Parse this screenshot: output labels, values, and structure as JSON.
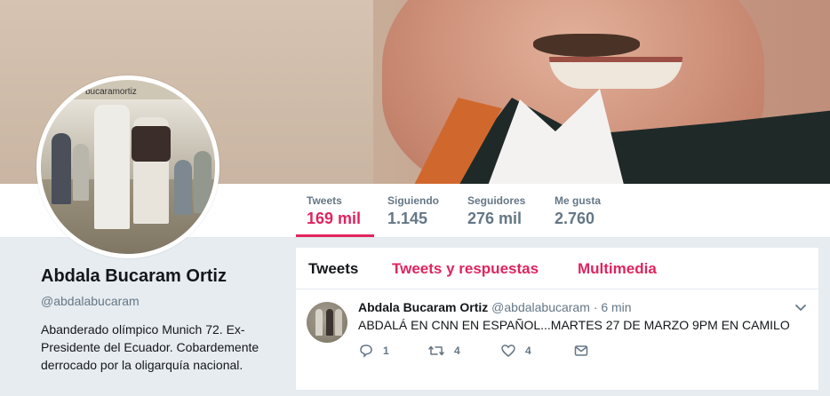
{
  "banner": {
    "description_icon": "banner-photo"
  },
  "avatar": {
    "caption": "bucaramortiz"
  },
  "nav": {
    "stats": [
      {
        "label": "Tweets",
        "value": "169 mil",
        "active": true
      },
      {
        "label": "Siguiendo",
        "value": "1.145"
      },
      {
        "label": "Seguidores",
        "value": "276 mil"
      },
      {
        "label": "Me gusta",
        "value": "2.760"
      }
    ]
  },
  "profile": {
    "name": "Abdala Bucaram Ortiz",
    "handle": "@abdalabucaram",
    "bio": "Abanderado olímpico Munich 72. Ex-Presidente del Ecuador. Cobardemente derrocado por la oligarquía nacional."
  },
  "timeline": {
    "tabs": [
      {
        "label": "Tweets",
        "current": true
      },
      {
        "label": "Tweets y respuestas"
      },
      {
        "label": "Multimedia"
      }
    ],
    "tweet": {
      "name": "Abdala Bucaram Ortiz",
      "handle": "@abdalabucaram",
      "separator": "·",
      "time": "6 min",
      "text": "ABDALÁ EN CNN EN ESPAÑOL...MARTES 27 DE MARZO 9PM EN CAMILO",
      "actions": {
        "reply_count": "1",
        "retweet_count": "4",
        "like_count": "4"
      }
    }
  },
  "colors": {
    "accent": "#e0245e",
    "muted": "#657786",
    "background": "#e6ecf0"
  }
}
